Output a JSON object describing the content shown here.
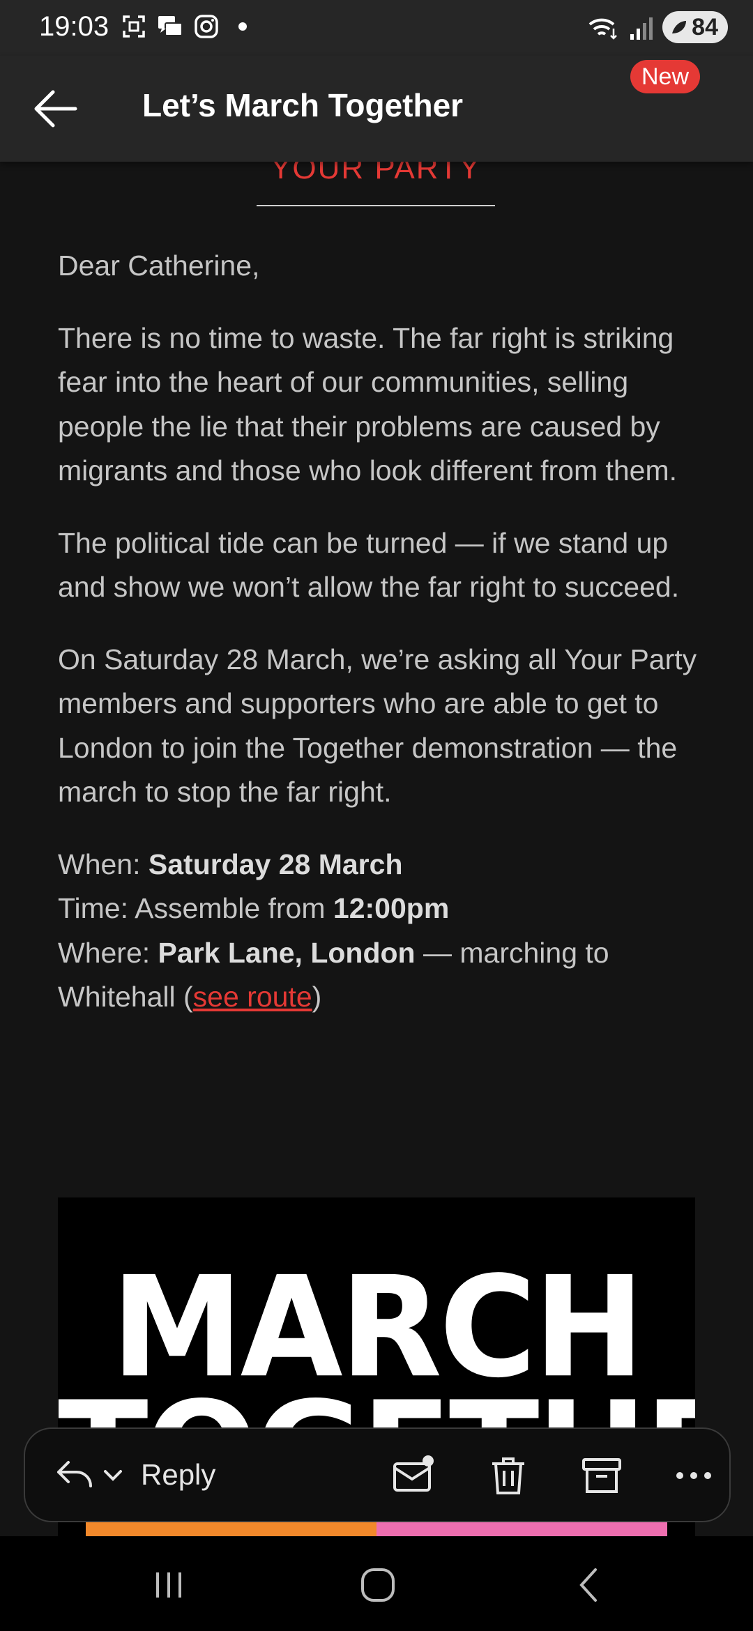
{
  "status_bar": {
    "time": "19:03",
    "battery": "84"
  },
  "app_bar": {
    "title": "Let’s March Together"
  },
  "email": {
    "party_name": "YOUR PARTY",
    "greeting": "Dear Catherine,",
    "para1": "There is no time to waste. The far right is striking fear into the heart of our communities, selling people the lie that their problems are caused by migrants and those who look different from them.",
    "para2": "The political tide can be turned — if we stand up and show we won’t allow the far right to succeed.",
    "para3": "On Saturday 28 March, we’re asking all Your Party members and supporters who are able to get to London to join the Together demonstration — the march to stop the far right.",
    "when_label": "When: ",
    "when_value": "Saturday 28 March",
    "time_label": "Time: Assemble from ",
    "time_value": "12:00pm",
    "where_label": "Where: ",
    "where_value": "Park Lane, London",
    "where_rest": " — marching to Whitehall (",
    "route_link": "see route",
    "where_close": ")",
    "poster_line1": "MARCH",
    "poster_line2": "TOGETHER"
  },
  "action_bar": {
    "reply_label": "Reply",
    "new_badge": "New"
  },
  "colors": {
    "accent": "#e53935",
    "background": "#141414",
    "bar": "#262626"
  }
}
